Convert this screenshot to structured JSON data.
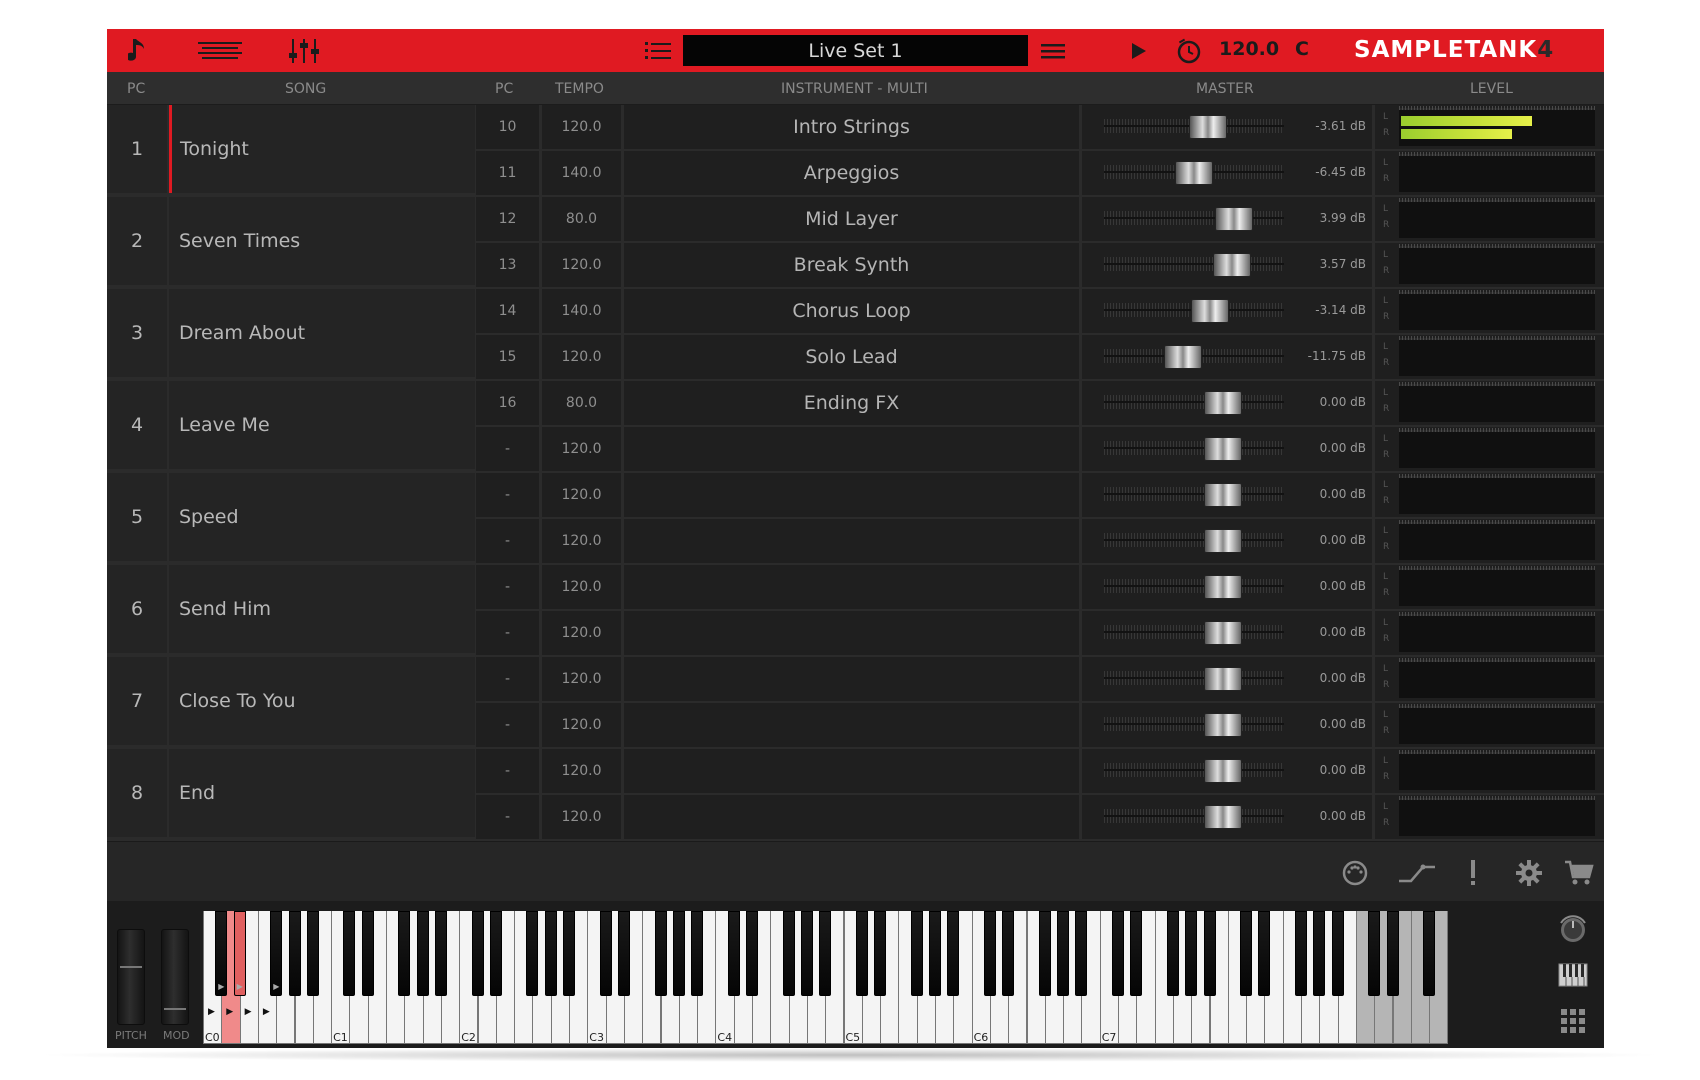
{
  "topbar": {
    "icons": [
      "note-icon",
      "hamburger-lines-icon",
      "mixer-sliders-icon",
      "list-icon",
      "menu-icon",
      "play-icon",
      "metronome-clock-icon"
    ],
    "title": "Live Set 1",
    "tempo": "120.0",
    "key": "C",
    "logo_text": "SAMPLETANK",
    "logo_number": "4",
    "accent_color": "#e01a22"
  },
  "columns": {
    "pc": "PC",
    "song": "SONG",
    "slot_pc": "PC",
    "tempo": "TEMPO",
    "instrument": "INSTRUMENT - MULTI",
    "master": "MASTER",
    "level": "LEVEL"
  },
  "songs": [
    {
      "pc": "1",
      "name": "Tonight"
    },
    {
      "pc": "2",
      "name": "Seven Times"
    },
    {
      "pc": "3",
      "name": "Dream About"
    },
    {
      "pc": "4",
      "name": "Leave Me"
    },
    {
      "pc": "5",
      "name": "Speed"
    },
    {
      "pc": "6",
      "name": "Send Him"
    },
    {
      "pc": "7",
      "name": "Close To You"
    },
    {
      "pc": "8",
      "name": "End"
    }
  ],
  "slots": [
    {
      "pc": "10",
      "tempo": "120.0",
      "instrument": "Intro Strings",
      "db": "-3.61 dB",
      "fader": 0.58,
      "level_l": 0.68,
      "level_r": 0.58
    },
    {
      "pc": "11",
      "tempo": "140.0",
      "instrument": "Arpeggios",
      "db": "-6.45 dB",
      "fader": 0.5,
      "level_l": 0,
      "level_r": 0
    },
    {
      "pc": "12",
      "tempo": "80.0",
      "instrument": "Mid Layer",
      "db": "3.99 dB",
      "fader": 0.72,
      "level_l": 0,
      "level_r": 0
    },
    {
      "pc": "13",
      "tempo": "120.0",
      "instrument": "Break Synth",
      "db": "3.57 dB",
      "fader": 0.71,
      "level_l": 0,
      "level_r": 0
    },
    {
      "pc": "14",
      "tempo": "140.0",
      "instrument": "Chorus Loop",
      "db": "-3.14 dB",
      "fader": 0.59,
      "level_l": 0,
      "level_r": 0
    },
    {
      "pc": "15",
      "tempo": "120.0",
      "instrument": "Solo Lead",
      "db": "-11.75 dB",
      "fader": 0.44,
      "level_l": 0,
      "level_r": 0
    },
    {
      "pc": "16",
      "tempo": "80.0",
      "instrument": "Ending FX",
      "db": "0.00 dB",
      "fader": 0.66,
      "level_l": 0,
      "level_r": 0
    },
    {
      "pc": "-",
      "tempo": "120.0",
      "instrument": "",
      "db": "0.00 dB",
      "fader": 0.66,
      "level_l": 0,
      "level_r": 0
    },
    {
      "pc": "-",
      "tempo": "120.0",
      "instrument": "",
      "db": "0.00 dB",
      "fader": 0.66,
      "level_l": 0,
      "level_r": 0
    },
    {
      "pc": "-",
      "tempo": "120.0",
      "instrument": "",
      "db": "0.00 dB",
      "fader": 0.66,
      "level_l": 0,
      "level_r": 0
    },
    {
      "pc": "-",
      "tempo": "120.0",
      "instrument": "",
      "db": "0.00 dB",
      "fader": 0.66,
      "level_l": 0,
      "level_r": 0
    },
    {
      "pc": "-",
      "tempo": "120.0",
      "instrument": "",
      "db": "0.00 dB",
      "fader": 0.66,
      "level_l": 0,
      "level_r": 0
    },
    {
      "pc": "-",
      "tempo": "120.0",
      "instrument": "",
      "db": "0.00 dB",
      "fader": 0.66,
      "level_l": 0,
      "level_r": 0
    },
    {
      "pc": "-",
      "tempo": "120.0",
      "instrument": "",
      "db": "0.00 dB",
      "fader": 0.66,
      "level_l": 0,
      "level_r": 0
    },
    {
      "pc": "-",
      "tempo": "120.0",
      "instrument": "",
      "db": "0.00 dB",
      "fader": 0.66,
      "level_l": 0,
      "level_r": 0
    },
    {
      "pc": "-",
      "tempo": "120.0",
      "instrument": "",
      "db": "0.00 dB",
      "fader": 0.66,
      "level_l": 0,
      "level_r": 0
    }
  ],
  "level_labels": {
    "l": "L",
    "r": "R"
  },
  "footer_icons": [
    "midi-port-icon",
    "curve-icon",
    "alert-icon",
    "gear-icon",
    "cart-icon"
  ],
  "wheels": {
    "pitch": "PITCH",
    "mod": "MOD"
  },
  "keyboard": {
    "octave_labels": [
      "C0",
      "C1",
      "C2",
      "C3",
      "C4",
      "C5",
      "C6",
      "C7"
    ],
    "pressed_color": "#f08a8a"
  },
  "side_icons": [
    "knob-icon",
    "piano-keys-icon",
    "grid-pads-icon"
  ]
}
